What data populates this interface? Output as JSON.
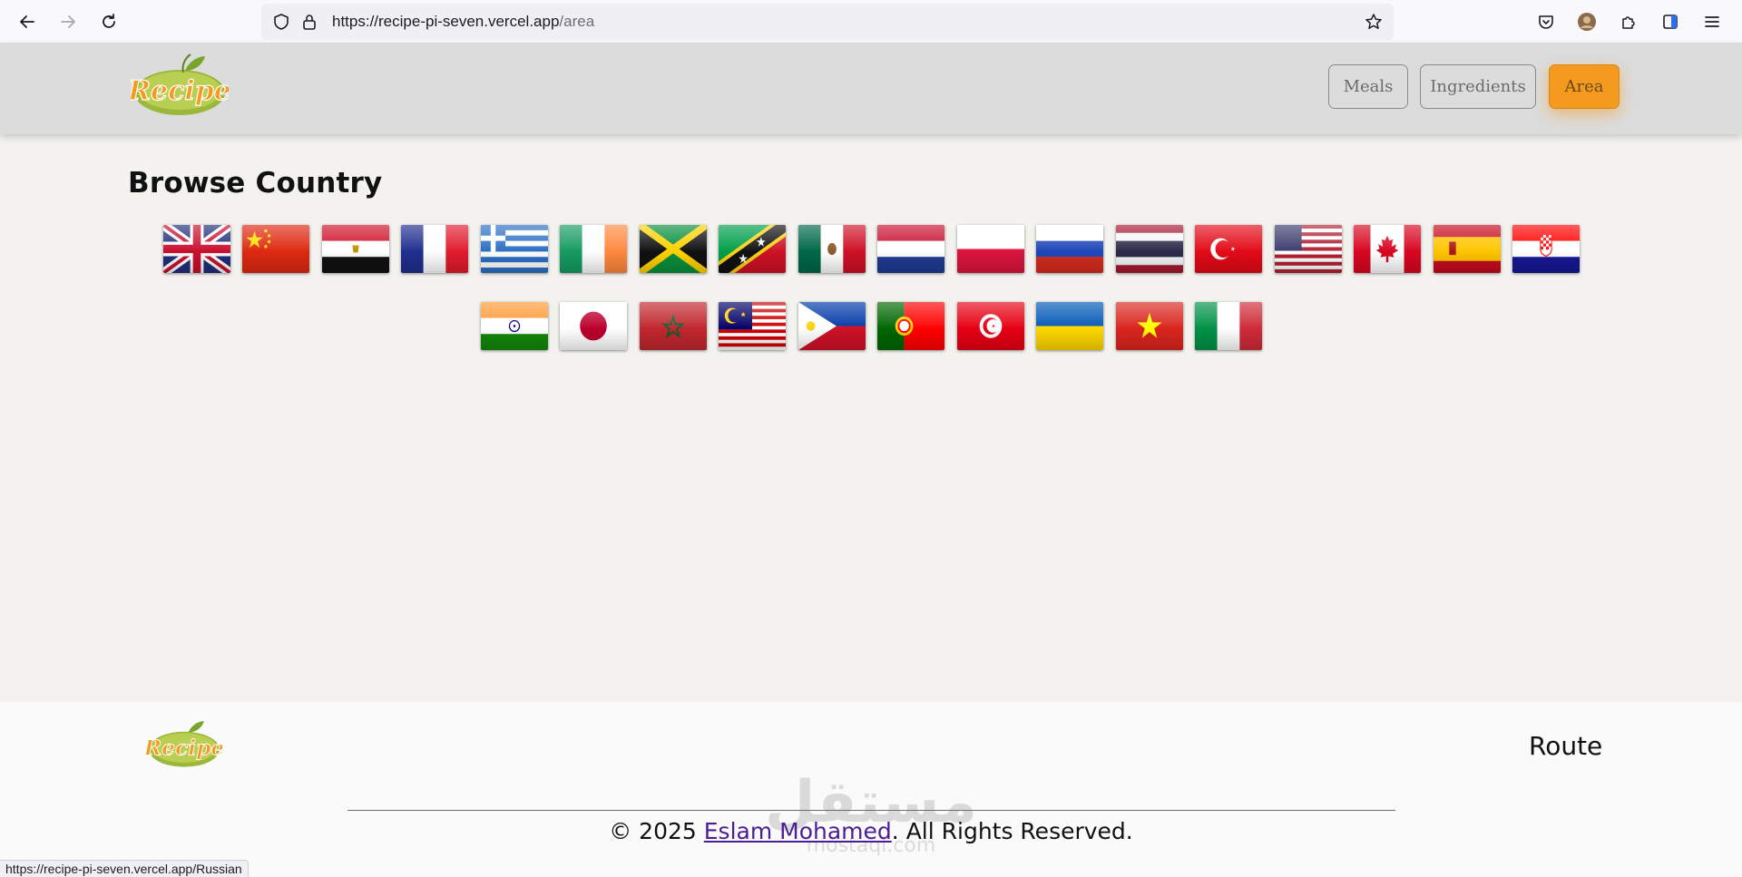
{
  "browser": {
    "url_host": "https://recipe-pi-seven.vercel.app",
    "url_path": "/area",
    "status_url": "https://recipe-pi-seven.vercel.app/Russian"
  },
  "header": {
    "logo_text": "Recipe",
    "nav": [
      {
        "label": "Meals",
        "active": false
      },
      {
        "label": "Ingredients",
        "active": false
      },
      {
        "label": "Area",
        "active": true
      }
    ]
  },
  "main": {
    "title": "Browse Country",
    "flags": [
      "british",
      "chinese",
      "egyptian",
      "french",
      "greek",
      "irish",
      "jamaican",
      "kittitian",
      "mexican",
      "dutch",
      "polish",
      "russian",
      "thai",
      "turkish",
      "american",
      "canadian",
      "spanish",
      "croatian",
      "indian",
      "japanese",
      "moroccan",
      "malaysian",
      "filipino",
      "portuguese",
      "tunisian",
      "ukrainian",
      "vietnamese",
      "italian"
    ]
  },
  "footer": {
    "logo_text": "Recipe",
    "route_label": "Route",
    "copyright_prefix": "© 2025 ",
    "author": "Eslam Mohamed",
    "copyright_suffix": ". All Rights Reserved.",
    "watermark_text": "مستقل",
    "watermark_sub": "mostaql.com"
  },
  "colors": {
    "accent": "#f39a1f",
    "header_bg": "#dcdcdc",
    "page_bg": "#f3f2ef",
    "link": "#4c1d95"
  }
}
